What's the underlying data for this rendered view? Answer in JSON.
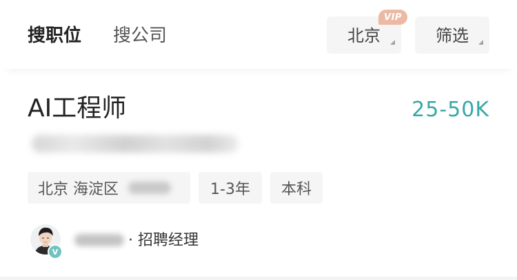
{
  "tabs": {
    "jobs": "搜职位",
    "companies": "搜公司"
  },
  "filters": {
    "city": "北京",
    "vip_badge": "VIP",
    "filter": "筛选"
  },
  "job": {
    "title": "AI工程师",
    "salary": "25-50K",
    "tags": {
      "location": "北京 海淀区",
      "experience": "1-3年",
      "education": "本科"
    },
    "recruiter": {
      "verified_badge": "V",
      "role": "· 招聘经理"
    }
  },
  "colors": {
    "salary": "#37a8a4",
    "vip": "#ecb9a4",
    "verify": "#6fc4c1"
  }
}
